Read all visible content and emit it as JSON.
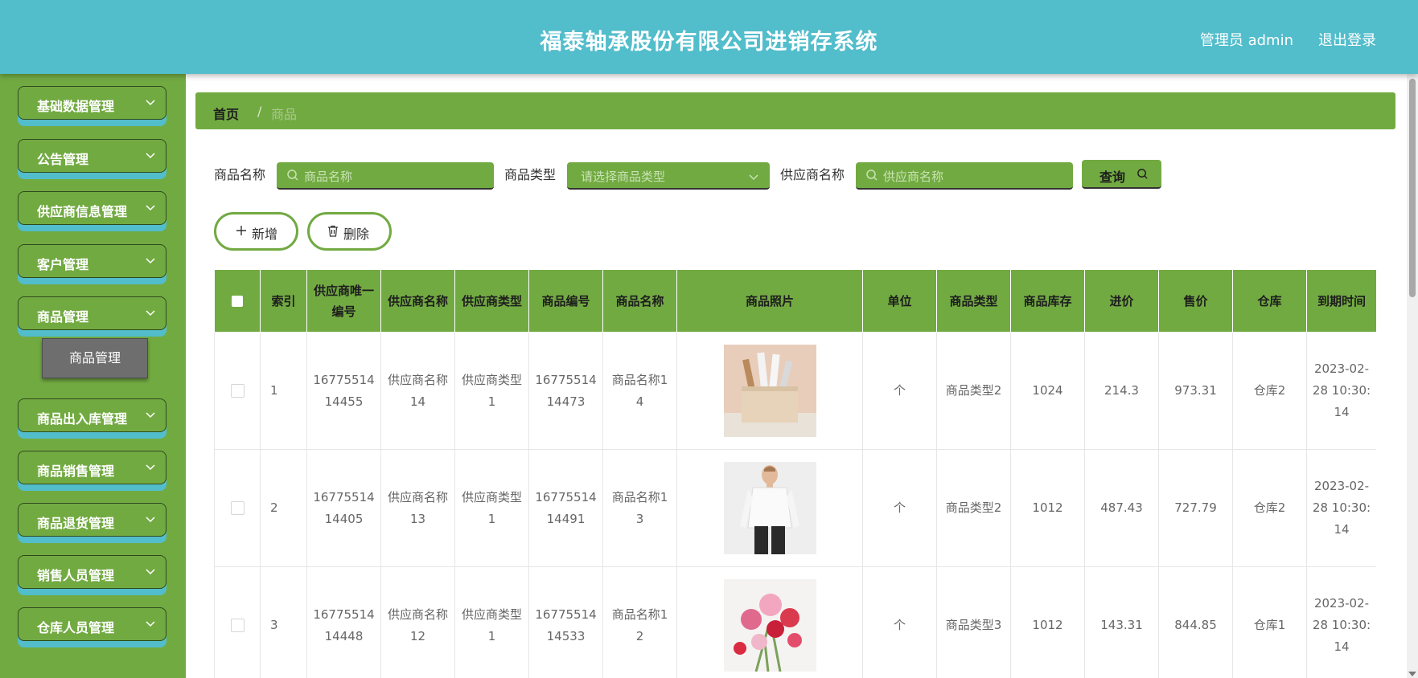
{
  "header": {
    "title": "福泰轴承股份有限公司进销存系统",
    "user": "管理员 admin",
    "logout": "退出登录"
  },
  "sidebar": {
    "items": [
      {
        "label": "基础数据管理"
      },
      {
        "label": "公告管理"
      },
      {
        "label": "供应商信息管理"
      },
      {
        "label": "客户管理"
      },
      {
        "label": "商品管理"
      },
      {
        "label": "商品出入库管理"
      },
      {
        "label": "商品销售管理"
      },
      {
        "label": "商品退货管理"
      },
      {
        "label": "销售人员管理"
      },
      {
        "label": "仓库人员管理"
      }
    ],
    "submenu": "商品管理"
  },
  "breadcrumb": {
    "home": "首页",
    "separator": "/",
    "current": "商品"
  },
  "search": {
    "name_label": "商品名称",
    "name_placeholder": "商品名称",
    "type_label": "商品类型",
    "type_placeholder": "请选择商品类型",
    "supplier_label": "供应商名称",
    "supplier_placeholder": "供应商名称",
    "query_label": "查询"
  },
  "actions": {
    "add": "新增",
    "delete": "删除"
  },
  "table": {
    "headers": [
      "索引",
      "供应商唯一编号",
      "供应商名称",
      "供应商类型",
      "商品编号",
      "商品名称",
      "商品照片",
      "单位",
      "商品类型",
      "商品库存",
      "进价",
      "售价",
      "仓库",
      "到期时间"
    ],
    "rows": [
      {
        "index": "1",
        "supplier_id": "1677551414455",
        "supplier_name": "供应商名称14",
        "supplier_type": "供应商类型1",
        "goods_id": "1677551414473",
        "goods_name": "商品名称14",
        "photo": "pens-in-holder",
        "unit": "个",
        "goods_type": "商品类型2",
        "stock": "1024",
        "cost": "214.3",
        "price": "973.31",
        "warehouse": "仓库2",
        "expire": "2023-02-28 10:30:14"
      },
      {
        "index": "2",
        "supplier_id": "1677551414405",
        "supplier_name": "供应商名称13",
        "supplier_type": "供应商类型1",
        "goods_id": "1677551414491",
        "goods_name": "商品名称13",
        "photo": "man-white-shirt",
        "unit": "个",
        "goods_type": "商品类型2",
        "stock": "1012",
        "cost": "487.43",
        "price": "727.79",
        "warehouse": "仓库2",
        "expire": "2023-02-28 10:30:14"
      },
      {
        "index": "3",
        "supplier_id": "1677551414448",
        "supplier_name": "供应商名称12",
        "supplier_type": "供应商类型1",
        "goods_id": "1677551414533",
        "goods_name": "商品名称12",
        "photo": "flowers",
        "unit": "个",
        "goods_type": "商品类型3",
        "stock": "1012",
        "cost": "143.31",
        "price": "844.85",
        "warehouse": "仓库1",
        "expire": "2023-02-28 10:30:14"
      }
    ]
  },
  "colors": {
    "header": "#52bdcb",
    "accent": "#72aa42",
    "submenu": "#6e6e6e"
  }
}
